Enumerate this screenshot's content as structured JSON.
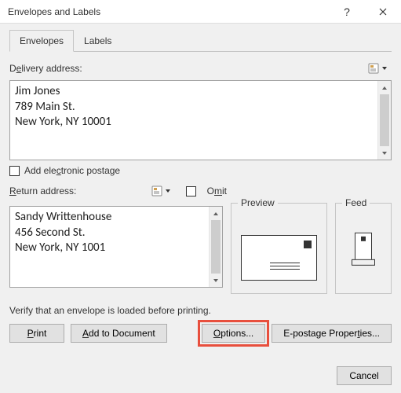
{
  "window": {
    "title": "Envelopes and Labels"
  },
  "tabs": {
    "envelopes": "Envelopes",
    "labels": "Labels"
  },
  "delivery": {
    "label_pre": "D",
    "label_u": "e",
    "label_post": "livery address:",
    "text": "Jim Jones\n789 Main St.\nNew York, NY 10001"
  },
  "electronic": {
    "pre": "Add ele",
    "u": "c",
    "post": "tronic postage"
  },
  "return": {
    "label_u": "R",
    "label_post": "eturn address:",
    "text": "Sandy Writtenhouse\n456 Second St.\nNew York, NY 1001"
  },
  "omit": {
    "pre": "O",
    "u": "m",
    "post": "it"
  },
  "preview_label": "Preview",
  "feed_label": "Feed",
  "verify": "Verify that an envelope is loaded before printing.",
  "buttons": {
    "print_u": "P",
    "print_post": "rint",
    "add_pre": "",
    "add_u": "A",
    "add_post": "dd to Document",
    "options_u": "O",
    "options_post": "ptions...",
    "epost_pre": "E-postage Proper",
    "epost_u": "t",
    "epost_post": "ies...",
    "cancel": "Cancel"
  }
}
